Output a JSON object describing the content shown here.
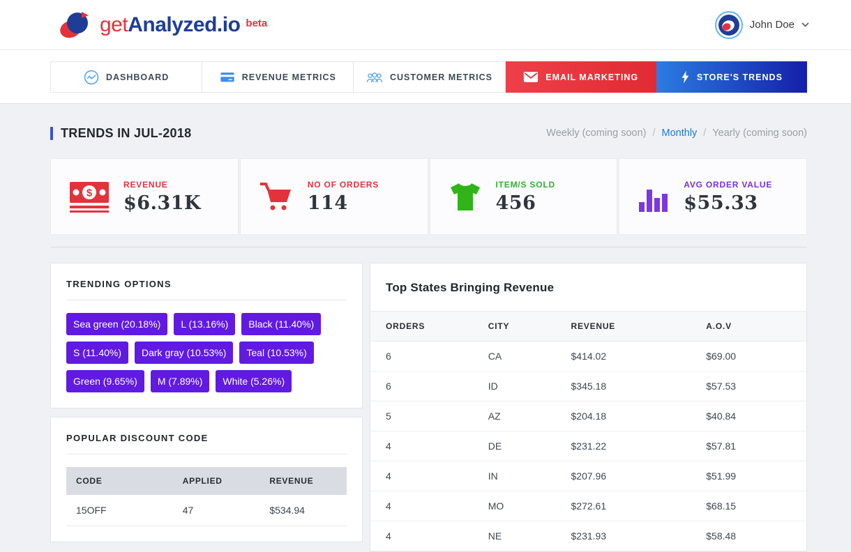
{
  "header": {
    "logo": {
      "prefix": "get",
      "name": "Analyzed.io",
      "badge": "beta"
    },
    "user": {
      "name": "John Doe"
    }
  },
  "nav": {
    "tabs": [
      {
        "label": "DASHBOARD",
        "active": false
      },
      {
        "label": "REVENUE METRICS",
        "active": false
      },
      {
        "label": "CUSTOMER METRICS",
        "active": false
      },
      {
        "label": "EMAIL MARKETING",
        "active": true
      },
      {
        "label": "STORE'S TRENDS",
        "active": true
      }
    ]
  },
  "page": {
    "title": "TRENDS IN JUL-2018",
    "separator": "/",
    "periods": [
      "Weekly (coming soon)",
      "Monthly",
      "Yearly (coming soon)"
    ],
    "selected_period": "Monthly"
  },
  "stats": [
    {
      "label": "REVENUE",
      "value": "$6.31K",
      "icon": "money-bill-icon",
      "color": "#e4323b"
    },
    {
      "label": "NO OF ORDERS",
      "value": "114",
      "icon": "shopping-cart-icon",
      "color": "#e4323b"
    },
    {
      "label": "ITEM/S SOLD",
      "value": "456",
      "icon": "tshirt-icon",
      "color": "#2cb32c"
    },
    {
      "label": "AVG ORDER VALUE",
      "value": "$55.33",
      "icon": "bar-chart-icon",
      "color": "#7a2fe2"
    }
  ],
  "icons": {
    "dollar_glyph": "$"
  },
  "trending": {
    "title": "TRENDING OPTIONS",
    "tags": [
      "Sea green (20.18%)",
      "L (13.16%)",
      "Black (11.40%)",
      "S (11.40%)",
      "Dark gray (10.53%)",
      "Teal (10.53%)",
      "Green (9.65%)",
      "M (7.89%)",
      "White (5.26%)"
    ],
    "tag_color": "#611ae2"
  },
  "discount": {
    "title": "POPULAR DISCOUNT CODE",
    "headers": [
      "CODE",
      "APPLIED",
      "REVENUE"
    ],
    "rows": [
      [
        "15OFF",
        "47",
        "$534.94"
      ]
    ]
  },
  "top_states": {
    "title": "Top States Bringing Revenue",
    "headers": [
      "ORDERS",
      "CITY",
      "REVENUE",
      "A.O.V"
    ],
    "rows": [
      [
        "6",
        "CA",
        "$414.02",
        "$69.00"
      ],
      [
        "6",
        "ID",
        "$345.18",
        "$57.53"
      ],
      [
        "5",
        "AZ",
        "$204.18",
        "$40.84"
      ],
      [
        "4",
        "DE",
        "$231.22",
        "$57.81"
      ],
      [
        "4",
        "IN",
        "$207.96",
        "$51.99"
      ],
      [
        "4",
        "MO",
        "$272.61",
        "$68.15"
      ],
      [
        "4",
        "NE",
        "$231.93",
        "$58.48"
      ]
    ]
  },
  "colors": {
    "accent_red": "#e4323b",
    "brand_navy": "#1e3d96",
    "link_blue": "#1c7be0",
    "tag_purple": "#611ae2",
    "stat_green": "#2cb32c",
    "stat_purple": "#7a2fe2",
    "trends_gradient_start": "#2b7ce2",
    "trends_gradient_end": "#151fa9",
    "page_background": "#f0f1f5"
  }
}
